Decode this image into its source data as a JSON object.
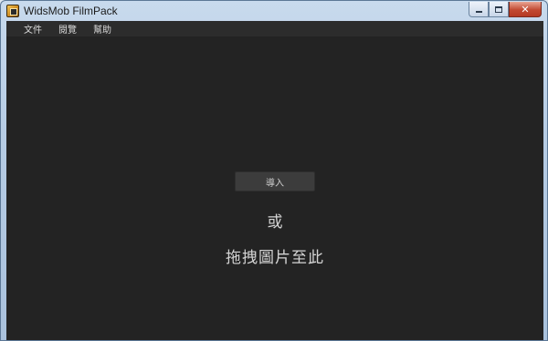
{
  "window": {
    "title": "WidsMob FilmPack",
    "controls": {
      "minimize_icon": "minimize-icon",
      "maximize_icon": "maximize-icon",
      "close_label": "✕"
    }
  },
  "menubar": {
    "items": [
      {
        "label": "文件"
      },
      {
        "label": "閱覽"
      },
      {
        "label": "幫助"
      }
    ]
  },
  "main": {
    "import_button_label": "導入",
    "or_text": "或",
    "drop_hint": "拖拽圖片至此"
  },
  "colors": {
    "canvas_bg": "#232323",
    "menubar_bg": "#2c2c2c",
    "button_bg": "#3c3c3c",
    "text": "#d4d4d4"
  }
}
